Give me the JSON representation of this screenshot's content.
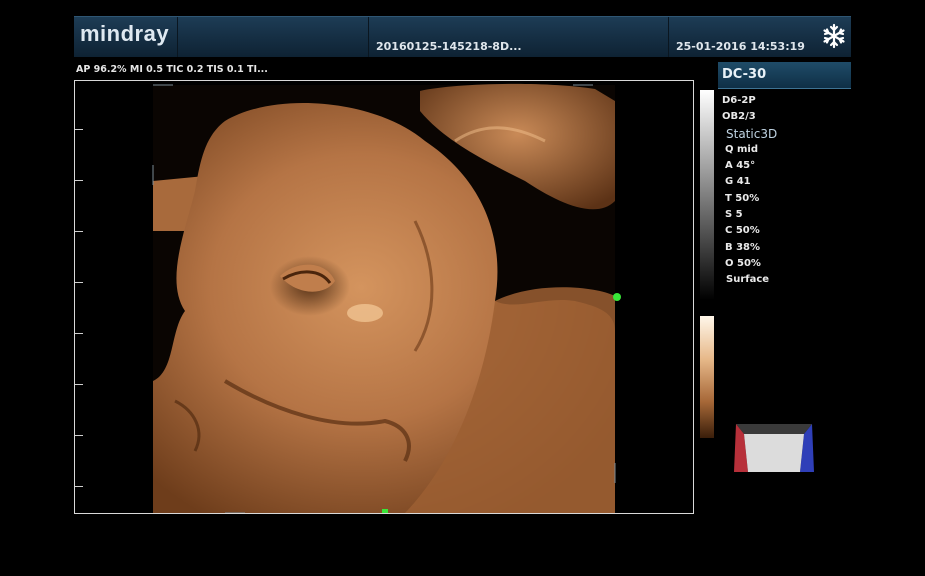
{
  "header": {
    "brand": "mindray",
    "file_id": "20160125-145218-8D...",
    "datetime": "25-01-2016 14:53:19",
    "freeze_icon": "snowflake-icon"
  },
  "params_line": "AP 96.2%  MI 0.5  TIC 0.2  TIS 0.1  TI...",
  "mode_tag": "DC-30",
  "side_params": {
    "probe": "D6-2P",
    "preset": "OB2/3",
    "mode": "Static3D",
    "quality": "Q mid",
    "angle": "A 45°",
    "gain": "G 41",
    "threshold": "T 50%",
    "smooth": "S 5",
    "contrast": "C 50%",
    "brightness": "B 38%",
    "opacity": "O 50%",
    "render_mode": "Surface"
  },
  "colors": {
    "header_bg": "#1d3c55",
    "accent_green": "#39e639",
    "skin_tone": "#b07043"
  }
}
